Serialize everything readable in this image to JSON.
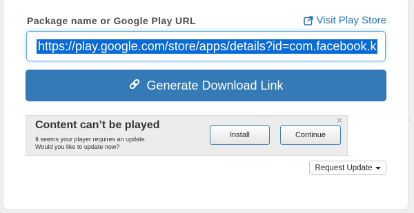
{
  "form": {
    "label": "Package name or Google Play URL",
    "store_link": "Visit Play Store",
    "url_value": "https://play.google.com/store/apps/details?id=com.facebook.k",
    "generate_label": "Generate Download Link"
  },
  "ad": {
    "title": "Content can’t be played",
    "line1": "It seems your player requires an update.",
    "line2": "Would you like to update now?",
    "install_label": "Install",
    "continue_label": "Continue",
    "close_glyph": "✕",
    "request_label": "Request Update"
  },
  "colors": {
    "primary": "#337ab7",
    "link": "#2a7ab8",
    "selection": "#0a6bd8"
  },
  "icons": {
    "store_link": "external-link-icon",
    "generate": "link-icon",
    "request": "caret-down-icon"
  }
}
